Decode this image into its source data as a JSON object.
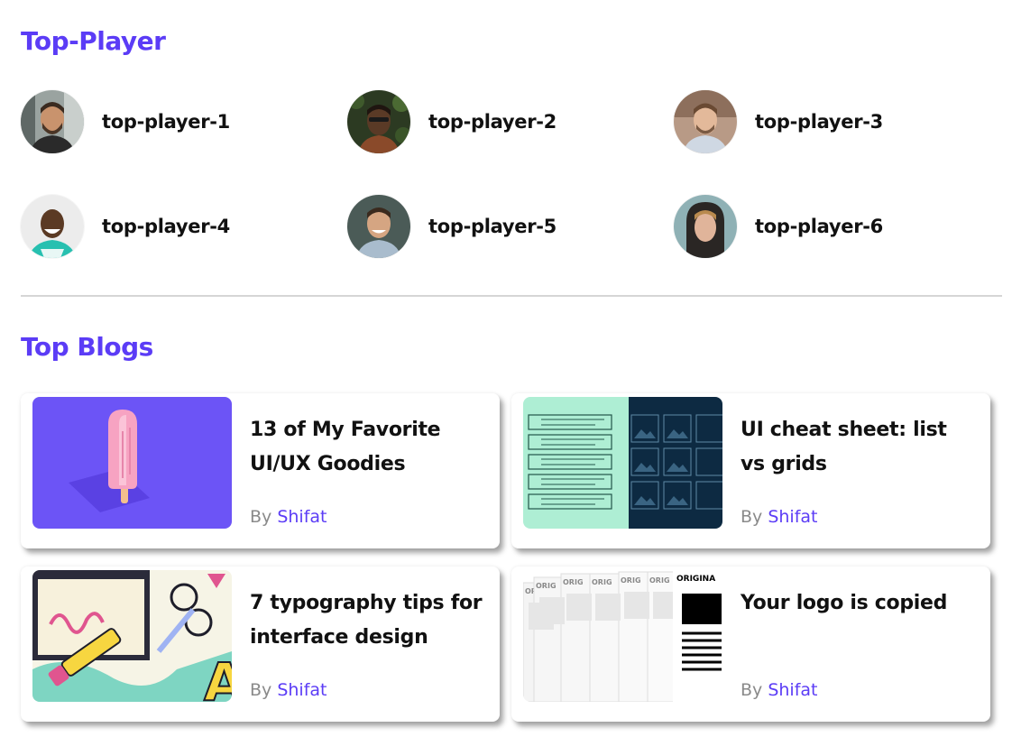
{
  "top_player": {
    "title": "Top-Player",
    "players": [
      {
        "name": "top-player-1"
      },
      {
        "name": "top-player-2"
      },
      {
        "name": "top-player-3"
      },
      {
        "name": "top-player-4"
      },
      {
        "name": "top-player-5"
      },
      {
        "name": "top-player-6"
      }
    ]
  },
  "top_blogs": {
    "title": "Top Blogs",
    "by_label": "By",
    "posts": [
      {
        "title": "13 of My Favorite UI/UX Goodies",
        "author": "Shifat"
      },
      {
        "title": "UI cheat sheet: list vs grids",
        "author": "Shifat"
      },
      {
        "title": "7 typography tips for interface design",
        "author": "Shifat"
      },
      {
        "title": "Your logo is copied",
        "author": "Shifat"
      }
    ],
    "thumb_text": {
      "logo_original": "ORIGINA",
      "logo_original_short": "ORIG"
    }
  },
  "colors": {
    "accent": "#5b3cf6",
    "text": "#111111",
    "muted": "#8a8a8a",
    "divider": "#d6d6d6"
  }
}
